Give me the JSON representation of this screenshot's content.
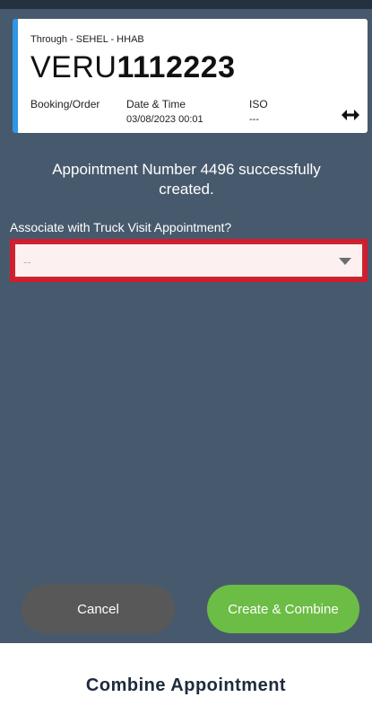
{
  "card": {
    "route": "Through - SEHEL - HHAB",
    "container_prefix": "VERU",
    "container_number": "1112223",
    "labels": {
      "booking": "Booking/Order",
      "datetime": "Date & Time",
      "iso": "ISO"
    },
    "values": {
      "datetime": "03/08/2023 00:01",
      "iso": "---"
    },
    "icon": "swap-horizontal-icon"
  },
  "message": "Appointment Number 4496 successfully created.",
  "associate": {
    "question": "Associate with Truck Visit Appointment?",
    "selected_value": "--"
  },
  "buttons": {
    "cancel": "Cancel",
    "create": "Create & Combine"
  },
  "footer_title": "Combine Appointment",
  "colors": {
    "background": "#475a6d",
    "accent_bar": "#2f96e8",
    "error_border": "#d7192d",
    "create_button": "#6cbd45",
    "cancel_button": "#585858"
  }
}
